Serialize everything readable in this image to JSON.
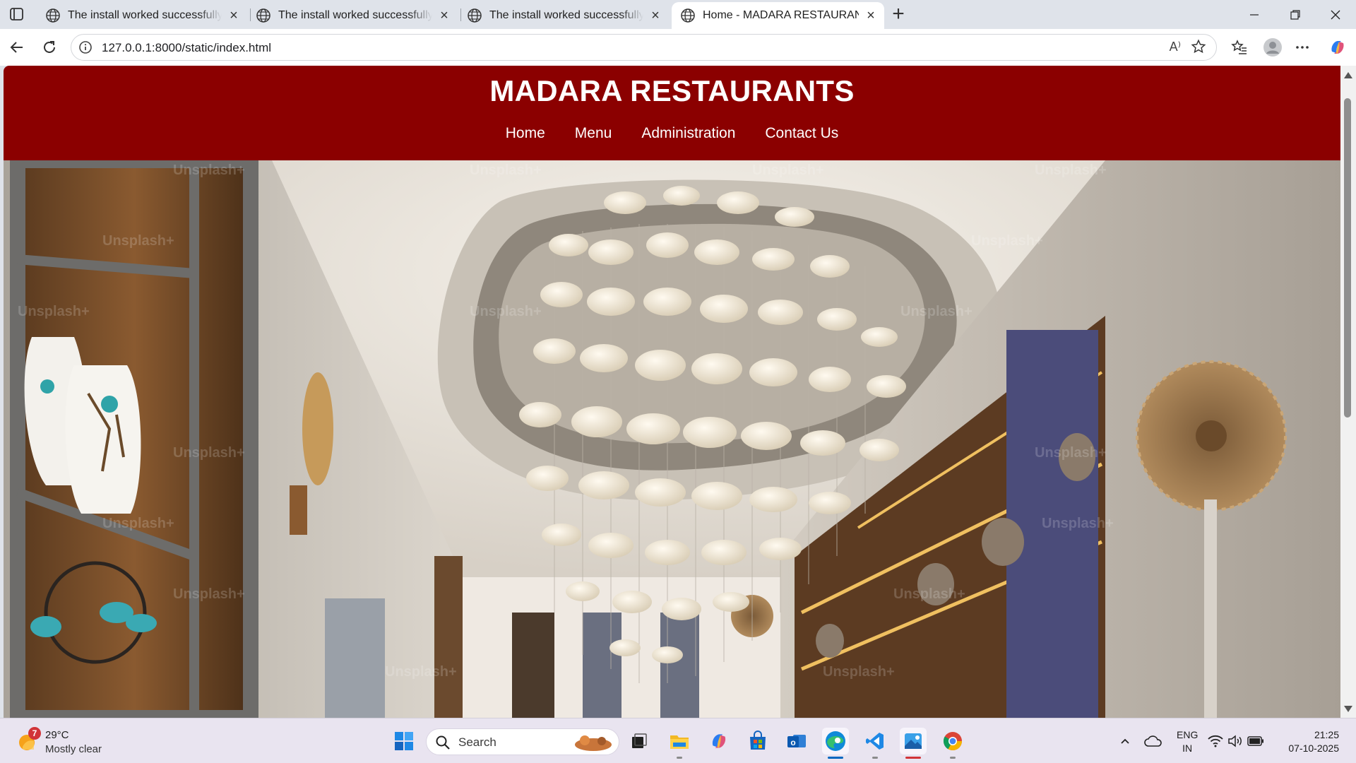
{
  "browser": {
    "tabs": [
      {
        "title": "The install worked successfully! Congratulations!",
        "active": false
      },
      {
        "title": "The install worked successfully! Congratulations!",
        "active": false
      },
      {
        "title": "The install worked successfully! Congratulations!",
        "active": false
      },
      {
        "title": "Home - MADARA RESTAURANTS",
        "active": true
      }
    ],
    "url": "127.0.0.1:8000/static/index.html",
    "read_aloud_glyph": "A⁾"
  },
  "site": {
    "title": "MADARA RESTAURANTS",
    "nav": [
      "Home",
      "Menu",
      "Administration",
      "Contact Us"
    ],
    "header_color": "#8b0000",
    "hero_watermark": "Unsplash+"
  },
  "taskbar": {
    "weather": {
      "badge": "7",
      "temp": "29°C",
      "condition": "Mostly clear"
    },
    "search_label": "Search",
    "lang_line1": "ENG",
    "lang_line2": "IN",
    "time": "21:25",
    "date": "07-10-2025"
  },
  "colors": {
    "accent": "#0067c0",
    "tab_strip": "#dfe3ea",
    "taskbar": "#e9e4f0"
  }
}
